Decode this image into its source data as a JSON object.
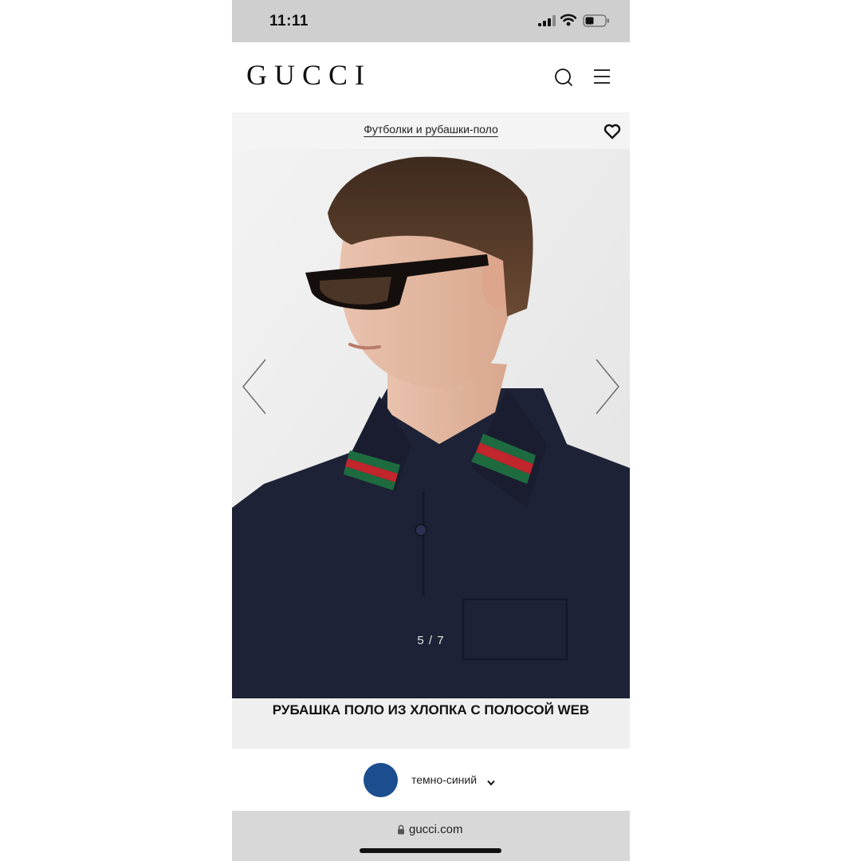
{
  "status_bar": {
    "time": "11:11"
  },
  "header": {
    "logo": "GUCCI",
    "icons": [
      "search-icon",
      "menu-icon"
    ]
  },
  "breadcrumb": {
    "label": "Футболки и рубашки-поло",
    "wishlist_icon": "heart-icon"
  },
  "gallery": {
    "counter": "5 / 7",
    "current": 5,
    "total": 7,
    "prev_icon": "chevron-left-icon",
    "next_icon": "chevron-right-icon",
    "image_description": "model wearing dark navy polo shirt with green-red-green Web stripe collar and black sunglasses"
  },
  "product": {
    "title": "РУБАШКА ПОЛО ИЗ ХЛОПКА С ПОЛОСОЙ WEB"
  },
  "color_selector": {
    "label": "темно-синий",
    "swatch_color": "#1c4e8f"
  },
  "browser": {
    "url": "gucci.com"
  },
  "colors": {
    "status_bar_bg": "#cfcfcf",
    "shirt_navy": "#1e2236",
    "stripe_red": "#c0262c",
    "stripe_green": "#1d6b3f"
  }
}
